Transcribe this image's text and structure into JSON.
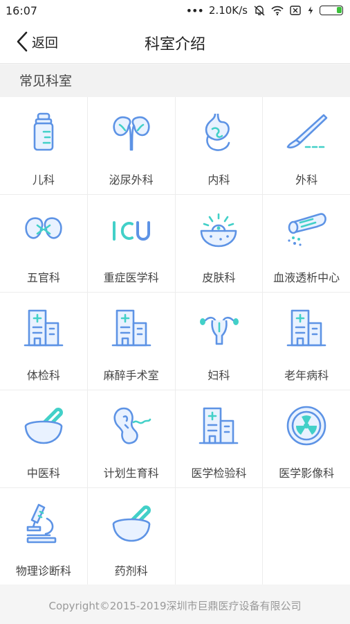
{
  "status": {
    "time": "16:07",
    "speed": "2.10K/s"
  },
  "nav": {
    "back_label": "返回",
    "title": "科室介绍"
  },
  "section": {
    "title": "常见科室"
  },
  "departments": [
    {
      "label": "儿科",
      "icon": "baby-bottle-icon"
    },
    {
      "label": "泌尿外科",
      "icon": "kidneys-icon"
    },
    {
      "label": "内科",
      "icon": "stomach-icon"
    },
    {
      "label": "外科",
      "icon": "scalpel-icon"
    },
    {
      "label": "五官科",
      "icon": "ent-icon"
    },
    {
      "label": "重症医学科",
      "icon": "icu-icon"
    },
    {
      "label": "皮肤科",
      "icon": "skin-icon"
    },
    {
      "label": "血液透析中心",
      "icon": "dialysis-icon"
    },
    {
      "label": "体检科",
      "icon": "hospital-building-icon"
    },
    {
      "label": "麻醉手术室",
      "icon": "hospital-building-icon"
    },
    {
      "label": "妇科",
      "icon": "uterus-icon"
    },
    {
      "label": "老年病科",
      "icon": "hospital-building-icon"
    },
    {
      "label": "中医科",
      "icon": "mortar-pestle-icon"
    },
    {
      "label": "计划生育科",
      "icon": "fetus-icon"
    },
    {
      "label": "医学检验科",
      "icon": "hospital-building-icon"
    },
    {
      "label": "医学影像科",
      "icon": "radiation-icon"
    },
    {
      "label": "物理诊断科",
      "icon": "microscope-icon"
    },
    {
      "label": "药剂科",
      "icon": "mortar-pestle-icon"
    }
  ],
  "footer": {
    "copyright": "Copyright©2015-2019深圳市巨鼎医疗设备有限公司"
  },
  "colors": {
    "icon_blue": "#5d93e5",
    "icon_teal": "#42d0c8"
  }
}
